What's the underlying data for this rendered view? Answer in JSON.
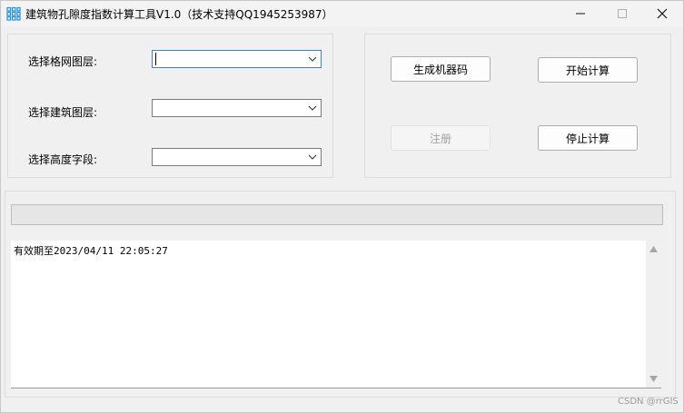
{
  "window": {
    "title": "建筑物孔隙度指数计算工具V1.0（技术支持QQ1945253987）"
  },
  "form": {
    "grid_layer_label": "选择格网图层:",
    "grid_layer_value": "",
    "building_layer_label": "选择建筑图层:",
    "building_layer_value": "",
    "height_field_label": "选择高度字段:",
    "height_field_value": ""
  },
  "actions": {
    "generate_code": "生成机器码",
    "start": "开始计算",
    "register": "注册",
    "stop": "停止计算"
  },
  "progress": {
    "value": 0
  },
  "log": {
    "text": "有效期至2023/04/11 22:05:27"
  },
  "watermark": {
    "text": "CSDN @rrGIS"
  },
  "icons": {
    "app": "grid-app-icon",
    "minimize": "minimize-icon",
    "maximize": "maximize-icon",
    "close": "close-icon",
    "dropdown": "chevron-down-icon"
  },
  "colors": {
    "progress_fill": "#06b025",
    "app_icon": "#1f8fd8"
  }
}
